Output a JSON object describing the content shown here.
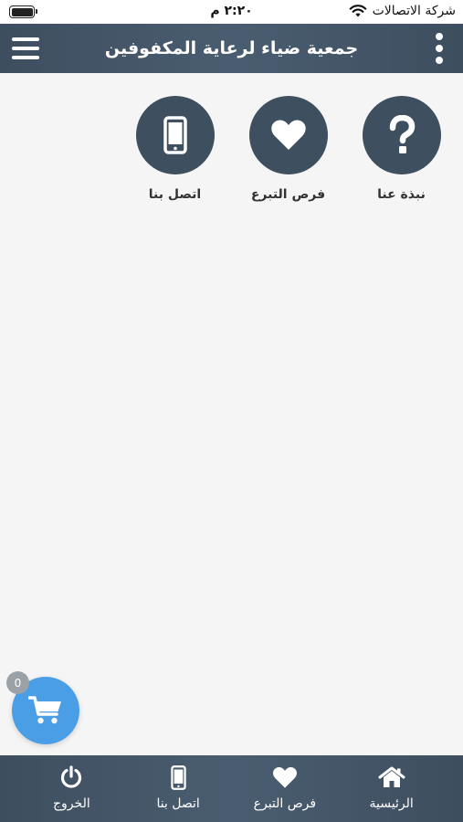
{
  "status_bar": {
    "carrier": "شركة الاتصالات",
    "time": "٢:٢٠ م"
  },
  "header": {
    "title": "جمعية ضياء لرعاية المكفوفين",
    "menu_icon": "hamburger-menu-icon",
    "more_icon": "vertical-dots-icon"
  },
  "tiles": [
    {
      "label": "نبذة عنا",
      "icon": "question-mark-icon"
    },
    {
      "label": "فرص التبرع",
      "icon": "heart-icon"
    },
    {
      "label": "اتصل بنا",
      "icon": "mobile-phone-icon"
    }
  ],
  "cart": {
    "count": "0",
    "icon": "cart-icon"
  },
  "bottom_nav": [
    {
      "label": "الرئيسية",
      "icon": "home-icon"
    },
    {
      "label": "فرص التبرع",
      "icon": "heart-icon"
    },
    {
      "label": "اتصل بنا",
      "icon": "mobile-phone-icon"
    },
    {
      "label": "الخروج",
      "icon": "power-icon"
    }
  ],
  "colors": {
    "header_bg": "#3d4e5f",
    "tile_circle": "#3e4f60",
    "cart_fab": "#4a9ee6",
    "badge": "#9aa1a7",
    "page_bg": "#f5f5f5"
  }
}
